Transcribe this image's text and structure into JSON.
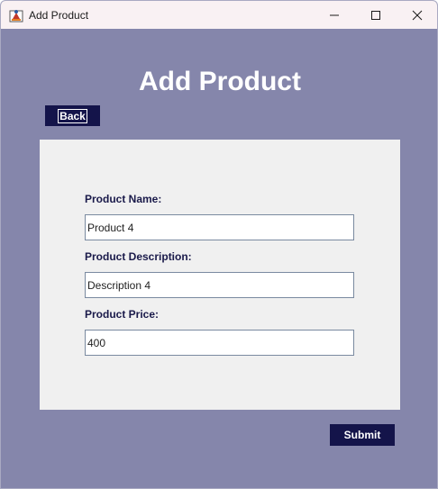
{
  "window": {
    "title": "Add Product"
  },
  "page": {
    "heading": "Add Product",
    "back_label": "Back",
    "submit_label": "Submit"
  },
  "form": {
    "name_label": "Product Name:",
    "name_value": "Product 4",
    "description_label": "Product Description:",
    "description_value": "Description 4",
    "price_label": "Product Price:",
    "price_value": "400"
  },
  "colors": {
    "background": "#8586ab",
    "button": "#14144a",
    "panel": "#f0f0f0",
    "label": "#1a1a4a"
  },
  "icons": {
    "app": "java-app-icon",
    "minimize": "minimize-icon",
    "maximize": "maximize-icon",
    "close": "close-icon"
  }
}
